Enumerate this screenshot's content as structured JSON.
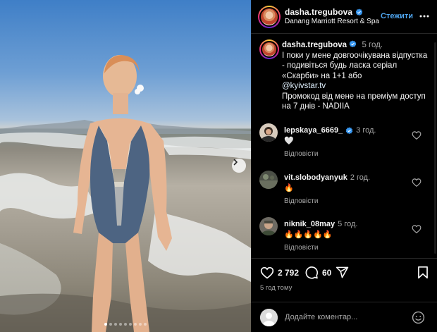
{
  "post": {
    "username": "dasha.tregubova",
    "location": "Danang Marriott Resort & Spa",
    "follow_label": "Стежити",
    "image_count": 9,
    "active_image": 0
  },
  "caption": {
    "username": "dasha.tregubova",
    "time": "5 год.",
    "line1": "І поки у мене довгоочікувана відпустка - подивіться будь ласка серіал «Скарби» на 1+1 або",
    "mention": "@kyivstar.tv",
    "line2": "Промокод від мене на преміум доступ на 7 днів - NADIIA"
  },
  "comments": [
    {
      "username": "lepskaya_6669_",
      "verified": true,
      "time": "3 год.",
      "text": "🤍",
      "reply_label": "Відповісти"
    },
    {
      "username": "vit.slobodyanyuk",
      "verified": false,
      "time": "2 год.",
      "text": "🔥",
      "reply_label": "Відповісти"
    },
    {
      "username": "niknik_08may",
      "verified": false,
      "time": "5 год.",
      "text": "🔥🔥🔥🔥🔥",
      "reply_label": "Відповісти"
    }
  ],
  "actions": {
    "likes": "2 792",
    "comments": "60",
    "time_ago": "5 год тому"
  },
  "add_comment": {
    "placeholder": "Додайте коментар..."
  },
  "colors": {
    "background": "#000000",
    "accent": "#4fa6f0",
    "verified": "#3897f0",
    "muted": "#a8a8a8"
  },
  "icons": [
    "verified-icon",
    "more-icon",
    "heart-icon",
    "comment-icon",
    "share-icon",
    "save-icon",
    "emoji-icon",
    "chevron-right-icon"
  ]
}
